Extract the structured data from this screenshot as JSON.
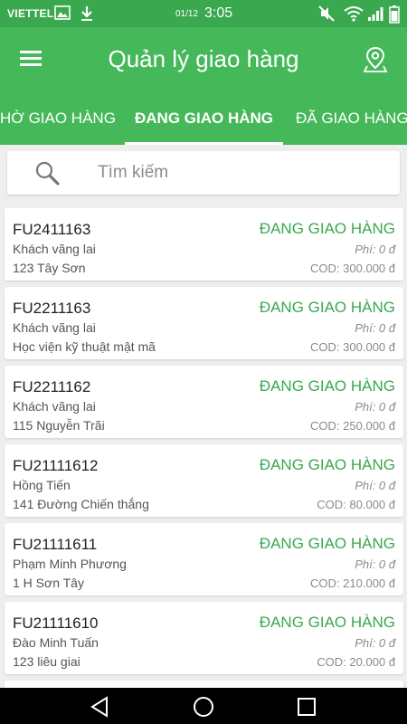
{
  "status_bar": {
    "carrier": "VIETTEL",
    "date": "01/12",
    "time": "3:05",
    "icons": [
      "image-icon",
      "download-icon",
      "mute-icon",
      "wifi-icon",
      "signal-icon",
      "battery-icon"
    ]
  },
  "header": {
    "title": "Quản lý giao hàng",
    "menu_icon": "hamburger-menu-icon",
    "map_icon": "map-pin-icon"
  },
  "tabs": [
    {
      "label": "HỜ GIAO HÀNG",
      "active": false
    },
    {
      "label": "ĐANG GIAO HÀNG",
      "active": true
    },
    {
      "label": "ĐÃ GIAO HÀNG",
      "active": false
    }
  ],
  "search": {
    "placeholder": "Tìm kiếm",
    "value": ""
  },
  "orders": [
    {
      "code": "FU2411163",
      "customer": "Khách vãng lai",
      "address": "123 Tây Sơn",
      "status": "ĐANG GIAO HÀNG",
      "fee": "Phí: 0 đ",
      "cod": "COD: 300.000 đ"
    },
    {
      "code": "FU2211163",
      "customer": "Khách vãng lai",
      "address": "Học viện kỹ thuật mật mã",
      "status": "ĐANG GIAO HÀNG",
      "fee": "Phí: 0 đ",
      "cod": "COD: 300.000 đ"
    },
    {
      "code": "FU2211162",
      "customer": "Khách vãng lai",
      "address": "115 Nguyễn Trãi",
      "status": "ĐANG GIAO HÀNG",
      "fee": "Phí: 0 đ",
      "cod": "COD: 250.000 đ"
    },
    {
      "code": "FU21111612",
      "customer": "Hồng Tiến",
      "address": "141 Đường Chiến thắng",
      "status": "ĐANG GIAO HÀNG",
      "fee": "Phí: 0 đ",
      "cod": "COD: 80.000 đ"
    },
    {
      "code": "FU21111611",
      "customer": "Phạm Minh Phương",
      "address": "1 H Sơn Tây",
      "status": "ĐANG GIAO HÀNG",
      "fee": "Phí: 0 đ",
      "cod": "COD: 210.000 đ"
    },
    {
      "code": "FU21111610",
      "customer": "Đào Minh Tuấn",
      "address": "123 liêu giai",
      "status": "ĐANG GIAO HÀNG",
      "fee": "Phí: 0 đ",
      "cod": "COD: 20.000 đ"
    },
    {
      "code": "",
      "customer": "",
      "address": "",
      "status": "",
      "fee": "",
      "cod": ""
    }
  ],
  "nav_bar": {
    "icons": [
      "back-icon",
      "home-icon",
      "recents-icon"
    ]
  },
  "colors": {
    "primary": "#45b85a",
    "status_bar": "#3aa84f",
    "status_text": "#3aa84f",
    "muted_text": "#8a8a8a"
  }
}
